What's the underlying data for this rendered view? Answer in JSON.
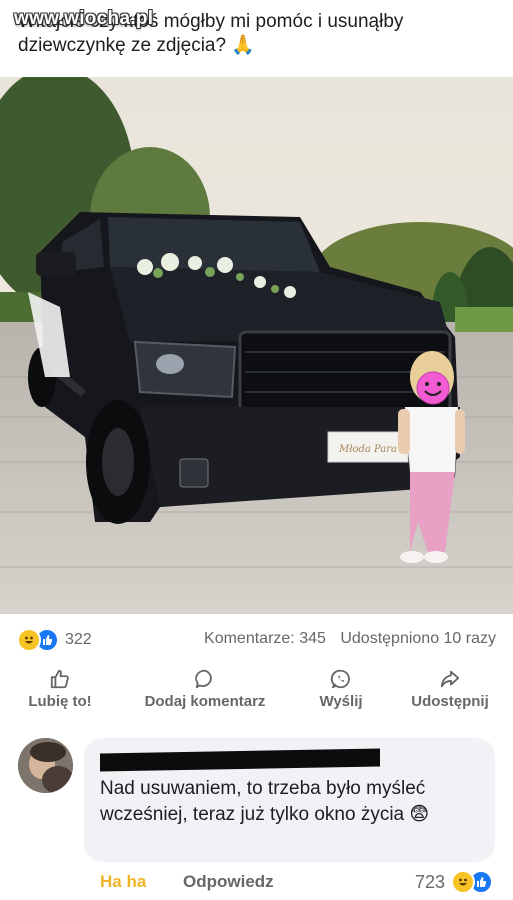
{
  "post": {
    "text": "Witajcie czy ktoś mógłby mi pomóc i usunąłby dziewczynkę ze zdjęcia? 🙏",
    "watermark": "www.wiocha.pl",
    "plate_text": "Młoda Para"
  },
  "stats": {
    "reaction_count": "322",
    "comments": "Komentarze: 345",
    "shares": "Udostępniono 10 razy"
  },
  "actions": {
    "like": "Lubię to!",
    "comment": "Dodaj komentarz",
    "send": "Wyślij",
    "share": "Udostępnij"
  },
  "comment": {
    "text": "Nad usuwaniem, to trzeba było myśleć wcześniej, teraz już tylko okno życia 😨",
    "haha": "Ha ha",
    "reply": "Odpowiedz",
    "reaction_count": "723"
  },
  "colors": {
    "like_blue": "#1877f2",
    "haha_yellow": "#f7c325",
    "muted_text": "#65676b",
    "bubble_bg": "#f0f2f5"
  }
}
